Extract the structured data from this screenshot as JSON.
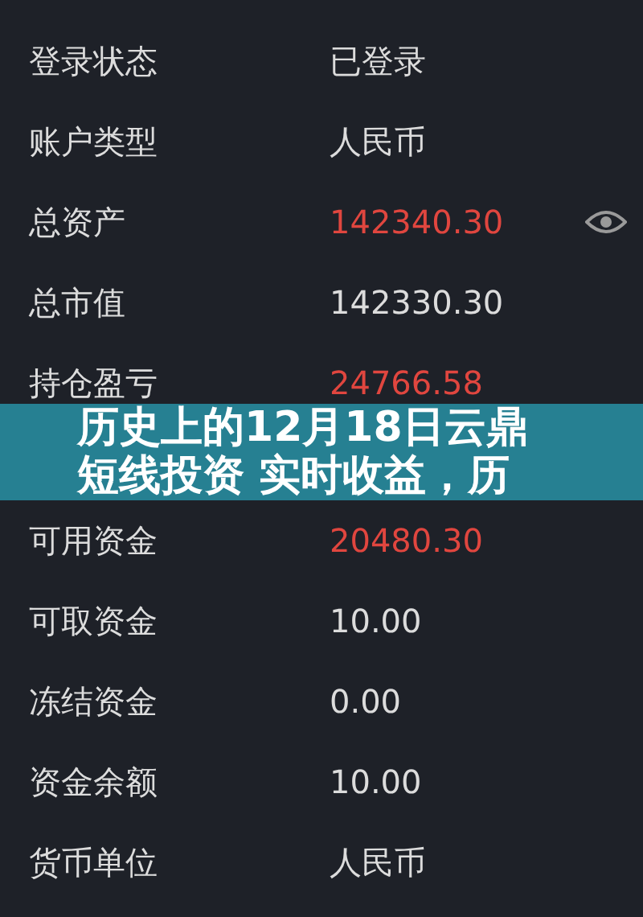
{
  "rows_above": [
    {
      "label": "登录状态",
      "value": "已登录",
      "color": "#dcdcdc",
      "eye": false
    },
    {
      "label": "账户类型",
      "value": "人民币",
      "color": "#dcdcdc",
      "eye": false
    },
    {
      "label": "总资产",
      "value": "142340.30",
      "color": "#e0463f",
      "eye": true
    },
    {
      "label": "总市值",
      "value": "142330.30",
      "color": "#dcdcdc",
      "eye": false
    },
    {
      "label": "持仓盈亏",
      "value": "24766.58",
      "color": "#e0463f",
      "eye": false
    }
  ],
  "banner": {
    "lines": [
      "历史上的12月18日云鼎",
      "短线投资 实时收益，历"
    ]
  },
  "rows_below": [
    {
      "label": "可用资金",
      "value": "20480.30",
      "color": "#e0463f",
      "eye": false
    },
    {
      "label": "可取资金",
      "value": "10.00",
      "color": "#dcdcdc",
      "eye": false
    },
    {
      "label": "冻结资金",
      "value": "0.00",
      "color": "#dcdcdc",
      "eye": false
    },
    {
      "label": "资金余额",
      "value": "10.00",
      "color": "#dcdcdc",
      "eye": false
    },
    {
      "label": "货币单位",
      "value": "人民币",
      "color": "#dcdcdc",
      "eye": false
    }
  ]
}
